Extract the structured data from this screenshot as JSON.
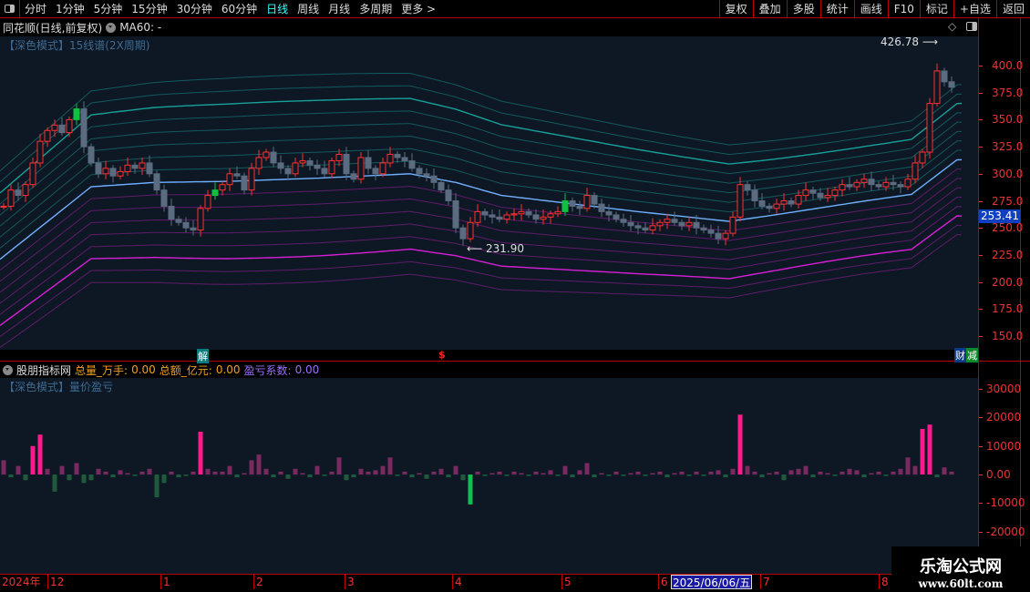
{
  "toolbar": {
    "periods": [
      "分时",
      "1分钟",
      "5分钟",
      "15分钟",
      "30分钟",
      "60分钟",
      "日线",
      "周线",
      "月线",
      "多周期",
      "更多 >"
    ],
    "active": "日线",
    "right_buttons": [
      "复权",
      "叠加",
      "多股",
      "统计",
      "画线",
      "F10",
      "标记",
      "+自选",
      "返回"
    ]
  },
  "title": {
    "name": "同花顺(日线,前复权)",
    "ma": "MA60: -"
  },
  "main": {
    "subtitle": "【深色模式】15线谱(2X周期)",
    "high_label": "426.78",
    "low_label": "231.90",
    "current_price": "253.41",
    "price_ticks": [
      "400.0",
      "375.0",
      "350.0",
      "325.0",
      "300.0",
      "275.0",
      "250.0",
      "225.0",
      "200.0",
      "175.0",
      "150.0"
    ],
    "markers": {
      "jie": "解",
      "dollar": "$",
      "cai": "财",
      "jian": "减"
    }
  },
  "indicator": {
    "source": "股朋指标网",
    "vol_label": "总量_万手:",
    "vol_value": "0.00",
    "amt_label": "总额_亿元:",
    "amt_value": "0.00",
    "coef_label": "盈亏系数:",
    "coef_value": "0.00",
    "subtitle": "【深色模式】量价盈亏",
    "ticks": [
      "30000",
      "20000",
      "10000",
      "0.00",
      "-10000",
      "-20000"
    ]
  },
  "date_axis": {
    "labels": [
      "2024年",
      "12",
      "1",
      "2",
      "3",
      "4",
      "5",
      "6",
      "7",
      "8"
    ],
    "selected": "2025/06/06/五"
  },
  "watermark": {
    "title": "乐淘公式网",
    "url": "www.60lt.com"
  },
  "colors": {
    "up": "#ff3030",
    "down": "#5b6b80",
    "center": "#6fb0ff",
    "upper": "#18a8a0",
    "lower": "#c020c0",
    "bg": "#0e1824"
  },
  "chart_data": {
    "type": "candlestick",
    "closes": [
      270,
      285,
      280,
      290,
      310,
      330,
      340,
      345,
      338,
      350,
      360,
      325,
      310,
      300,
      305,
      298,
      302,
      308,
      305,
      310,
      300,
      285,
      270,
      258,
      255,
      250,
      248,
      268,
      280,
      285,
      290,
      300,
      298,
      285,
      305,
      315,
      320,
      310,
      305,
      300,
      310,
      312,
      308,
      305,
      300,
      312,
      318,
      300,
      295,
      315,
      305,
      300,
      310,
      318,
      315,
      312,
      305,
      300,
      298,
      292,
      285,
      275,
      250,
      240,
      255,
      265,
      262,
      260,
      258,
      262,
      263,
      265,
      262,
      258,
      260,
      263,
      265,
      275,
      270,
      268,
      280,
      272,
      265,
      262,
      258,
      255,
      252,
      250,
      248,
      252,
      255,
      258,
      255,
      252,
      255,
      250,
      248,
      245,
      240,
      245,
      260,
      290,
      285,
      275,
      270,
      268,
      272,
      275,
      272,
      280,
      285,
      282,
      278,
      280,
      285,
      290,
      288,
      292,
      295,
      290,
      288,
      292,
      290,
      288,
      295,
      310,
      320,
      365,
      395,
      385,
      380
    ],
    "center_band": [
      [
        0,
        221
      ],
      [
        100,
        288
      ],
      [
        170,
        292
      ],
      [
        250,
        293
      ],
      [
        350,
        296
      ],
      [
        450,
        300
      ],
      [
        500,
        292
      ],
      [
        550,
        280
      ],
      [
        700,
        265
      ],
      [
        800,
        256
      ],
      [
        850,
        262
      ],
      [
        950,
        275
      ],
      [
        1000,
        281
      ],
      [
        1050,
        313
      ]
    ],
    "band_offsets": [
      -96,
      -84,
      -72,
      -60,
      -48,
      -36,
      -24,
      -12,
      0,
      12,
      24,
      36,
      48,
      60,
      72,
      84,
      96
    ],
    "volume": [
      5000,
      -1000,
      3000,
      -2000,
      10000,
      14000,
      2000,
      -6000,
      3000,
      -2000,
      4000,
      -3000,
      -2000,
      2000,
      1000,
      -1000,
      1500,
      500,
      -500,
      1000,
      2000,
      -8000,
      -3000,
      1000,
      -1000,
      -500,
      1000,
      15000,
      2000,
      1000,
      1000,
      3000,
      -1000,
      500,
      5000,
      7000,
      2000,
      -1000,
      1000,
      -1500,
      2000,
      500,
      -1000,
      3000,
      -500,
      1000,
      6000,
      -2000,
      -1000,
      2000,
      1000,
      1500,
      3000,
      6000,
      -500,
      1000,
      -1000,
      500,
      -1500,
      1000,
      2000,
      -1000,
      3000,
      -2000,
      -10500,
      1000,
      -500,
      500,
      1000,
      -500,
      1000,
      500,
      -500,
      1000,
      500,
      1500,
      -500,
      3000,
      -1000,
      1500,
      4000,
      -1000,
      500,
      -500,
      1000,
      -500,
      500,
      1000,
      -500,
      500,
      1000,
      -1000,
      500,
      1000,
      -500,
      1000,
      -500,
      1000,
      1500,
      -1000,
      2000,
      21000,
      3000,
      1000,
      -1000,
      500,
      1000,
      -2000,
      1500,
      2000,
      3000,
      -1000,
      1000,
      500,
      -500,
      1000,
      2000,
      1500,
      -1000,
      500,
      1000,
      -500,
      1000,
      2000,
      6000,
      3000,
      16000,
      17500,
      -1000,
      2500,
      1000
    ],
    "price_range": [
      140,
      430
    ],
    "volume_range": [
      -30000,
      38000
    ]
  }
}
